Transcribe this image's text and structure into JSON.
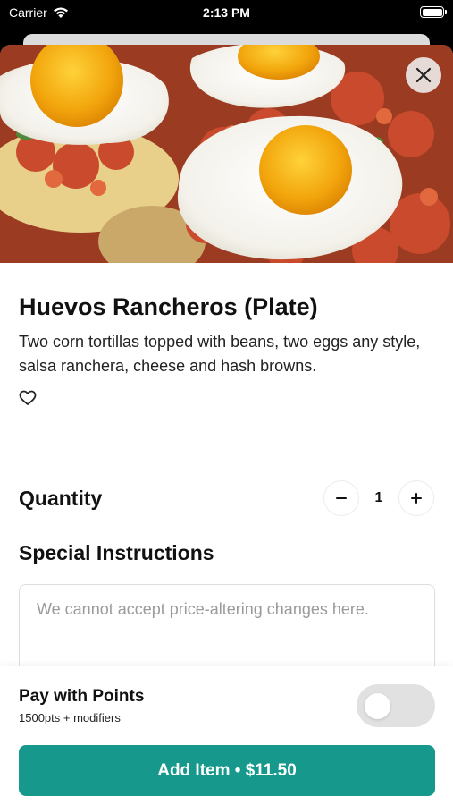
{
  "status_bar": {
    "carrier": "Carrier",
    "time": "2:13 PM"
  },
  "item": {
    "image": "huevos-rancheros-photo",
    "title": "Huevos Rancheros (Plate)",
    "description": "Two corn tortillas topped with beans, two eggs any style, salsa ranchera, cheese and hash browns.",
    "favorite_icon": "heart-outline-icon",
    "close_icon": "close-icon"
  },
  "quantity": {
    "label": "Quantity",
    "value": "1",
    "decrement_icon": "minus-icon",
    "increment_icon": "plus-icon"
  },
  "special_instructions": {
    "label": "Special Instructions",
    "placeholder": "We cannot accept price-altering changes here.",
    "value": ""
  },
  "footer": {
    "pay_with_points_label": "Pay with Points",
    "points_text": "1500pts + modifiers",
    "toggle_on": false,
    "add_button_label": "Add Item • $11.50"
  },
  "colors": {
    "accent": "#16998c",
    "toggle_off": "#e1e1e1"
  }
}
